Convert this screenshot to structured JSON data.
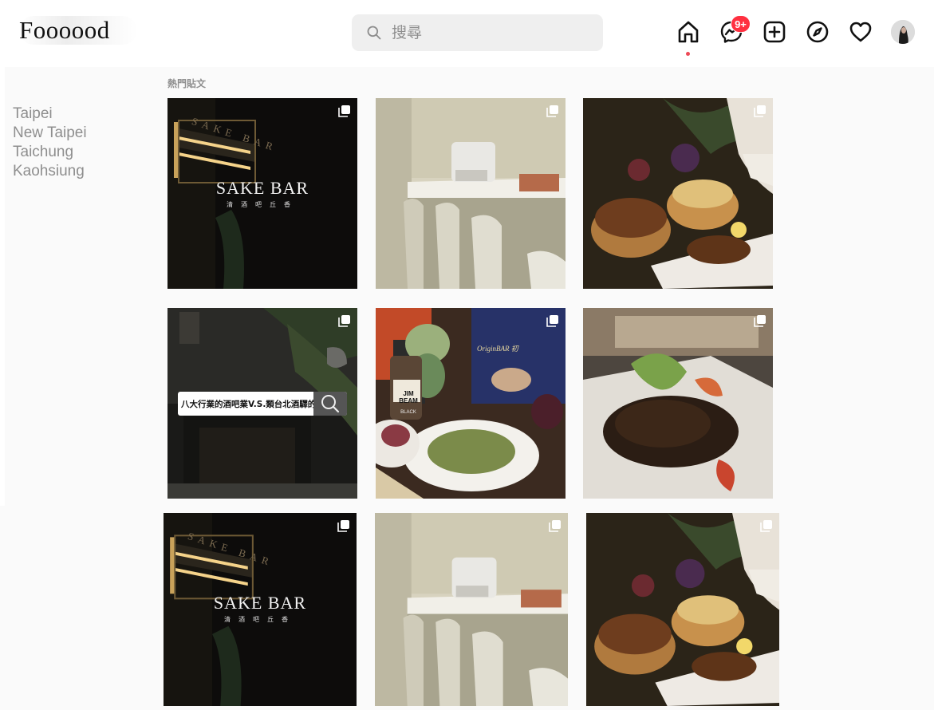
{
  "app": {
    "logo": "Foooood"
  },
  "search": {
    "placeholder": "搜尋"
  },
  "nav": {
    "icons": [
      "home-icon",
      "messenger-icon",
      "new-post-icon",
      "explore-icon",
      "activity-heart-icon",
      "avatar"
    ],
    "messages_badge": "9+",
    "accent": "#ed4956"
  },
  "sidebar": {
    "cities": [
      {
        "label": "Taipei"
      },
      {
        "label": "New Taipei"
      },
      {
        "label": "Taichung"
      },
      {
        "label": "Kaohsiung"
      }
    ]
  },
  "feed": {
    "section_title": "熱門貼文",
    "posts": [
      {
        "title": "SAKE BAR",
        "subtitle": "清酒吧丘香",
        "sign": "SAKE BAR"
      },
      {
        "title": ""
      },
      {
        "title": ""
      },
      {
        "overlay_text": "八大行業的酒吧業V.S.類台北酒驛的酒吧？"
      },
      {
        "label": "JIM BEAM",
        "label2": "BLACK",
        "menu": "OriginBAR 初"
      },
      {
        "title": ""
      },
      {
        "title": "SAKE BAR",
        "subtitle": "清酒吧丘香",
        "sign": "SAKE BAR"
      },
      {
        "title": ""
      },
      {
        "title": ""
      }
    ]
  }
}
